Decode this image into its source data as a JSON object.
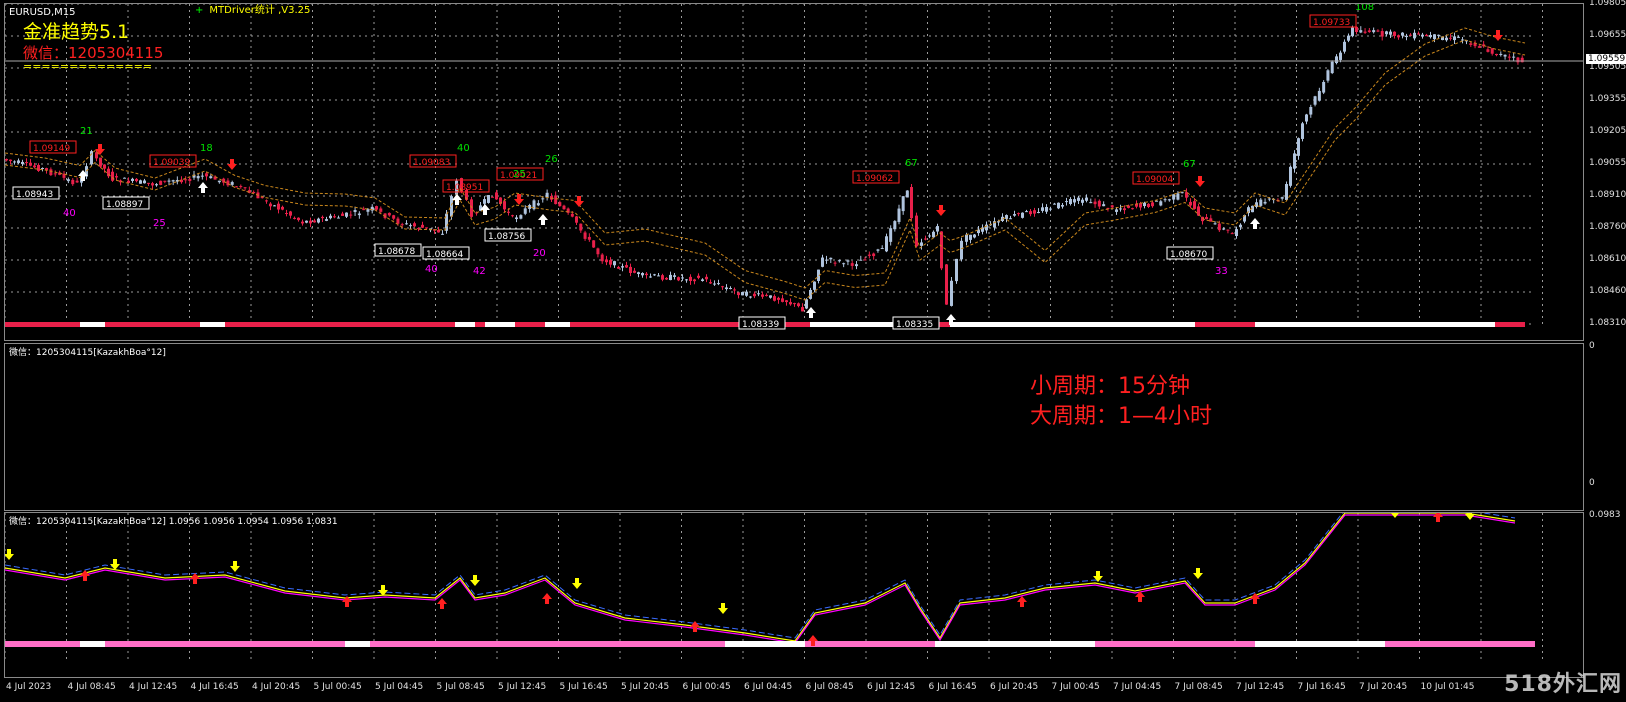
{
  "window": {
    "symbol_label": "EURUSD,M15",
    "mt_driver_label": "MTDriver统计 ,V3.25",
    "indicator_title": "金准趋势5.1",
    "contact_label": "微信：1205304115",
    "divider_text": "=============="
  },
  "notes": {
    "line1": "小周期：15分钟",
    "line2": "大周期：1—4小时"
  },
  "indicator1": {
    "label": "微信：1205304115[KazakhBoa°12]",
    "axis_top": "0",
    "axis_bottom": "0"
  },
  "indicator2": {
    "label": "微信：1205304115[KazakhBoa°12]  1.0956 1.0956 1.0954 1.0956 1.0831",
    "axis_top": "0.0983"
  },
  "price_axis": [
    "1.09805",
    "1.09655",
    "1.09505",
    "1.09355",
    "1.09205",
    "1.09055",
    "1.08910",
    "1.08760",
    "1.08610",
    "1.08460",
    "1.08310"
  ],
  "current_price": "1.09559",
  "time_axis": [
    "4 Jul 2023",
    "4 Jul 08:45",
    "4 Jul 12:45",
    "4 Jul 16:45",
    "4 Jul 20:45",
    "5 Jul 00:45",
    "5 Jul 04:45",
    "5 Jul 08:45",
    "5 Jul 12:45",
    "5 Jul 16:45",
    "5 Jul 20:45",
    "6 Jul 00:45",
    "6 Jul 04:45",
    "6 Jul 08:45",
    "6 Jul 12:45",
    "6 Jul 16:45",
    "6 Jul 20:45",
    "7 Jul 00:45",
    "7 Jul 04:45",
    "7 Jul 08:45",
    "7 Jul 12:45",
    "7 Jul 16:45",
    "7 Jul 20:45",
    "10 Jul 01:45"
  ],
  "red_price_boxes": [
    "1.09149",
    "1.09039",
    "1.09083",
    "1.08951",
    "1.09021",
    "1.09062",
    "1.09004",
    "1.09733"
  ],
  "white_price_boxes": [
    "1.08943",
    "1.08897",
    "1.08678",
    "1.08664",
    "1.08756",
    "1.08339",
    "1.08335",
    "1.08670"
  ],
  "green_counts": [
    "21",
    "18",
    "40",
    "25",
    "26",
    "67",
    "67",
    "108"
  ],
  "magenta_counts": [
    "40",
    "25",
    "40",
    "42",
    "20",
    "33"
  ],
  "watermark": "518外汇网",
  "colors": {
    "bull_candle": "#b0c4de",
    "bear_candle": "#e8204a",
    "ma_line": "#c8861c",
    "grid": "#9a9a9a",
    "yellow": "#ffff00",
    "magenta": "#ff00ff",
    "blue_dash": "#3a6cff",
    "red_arrow": "#ff2020",
    "green_text": "#00e000"
  }
}
